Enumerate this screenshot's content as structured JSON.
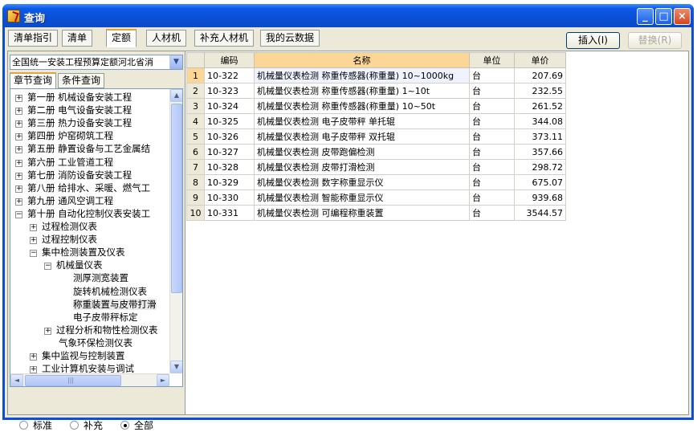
{
  "window": {
    "title": "查询",
    "controls": {
      "minimize": "_",
      "maximize": "□",
      "close": "×"
    }
  },
  "tabs": [
    {
      "label": "清单指引"
    },
    {
      "label": "清单"
    },
    {
      "label": "定额"
    },
    {
      "label": "人材机"
    },
    {
      "label": "补充人材机"
    },
    {
      "label": "我的云数据"
    }
  ],
  "actions": {
    "insert": "插入(I)",
    "replace": "替换(R)"
  },
  "left_panel": {
    "combo_value": "全国统一安装工程预算定额河北省消",
    "subtabs": [
      {
        "label": "章节查询"
      },
      {
        "label": "条件查询"
      }
    ],
    "tree": [
      {
        "label": "第一册  机械设备安装工程",
        "exp": "+"
      },
      {
        "label": "第二册  电气设备安装工程",
        "exp": "+"
      },
      {
        "label": "第三册  热力设备安装工程",
        "exp": "+"
      },
      {
        "label": "第四册  炉窑砌筑工程",
        "exp": "+"
      },
      {
        "label": "第五册  静置设备与工艺金属结",
        "exp": "+"
      },
      {
        "label": "第六册  工业管道工程",
        "exp": "+"
      },
      {
        "label": "第七册  消防设备安装工程",
        "exp": "+"
      },
      {
        "label": "第八册  给排水、采暖、燃气工",
        "exp": "+"
      },
      {
        "label": "第九册  通风空调工程",
        "exp": "+"
      },
      {
        "label": "第十册  自动化控制仪表安装工",
        "exp": "−"
      },
      {
        "label": "过程检测仪表",
        "exp": "+"
      },
      {
        "label": "过程控制仪表",
        "exp": "+"
      },
      {
        "label": "集中检测装置及仪表",
        "exp": "−"
      },
      {
        "label": "机械量仪表",
        "exp": "−"
      },
      {
        "label": "测厚测宽装置",
        "exp": ""
      },
      {
        "label": "旋转机械检测仪表",
        "exp": ""
      },
      {
        "label": "称重装置与皮带打滑",
        "exp": ""
      },
      {
        "label": "电子皮带秤标定",
        "exp": ""
      },
      {
        "label": "过程分析和物性检测仪表",
        "exp": "+"
      },
      {
        "label": "气象环保检测仪表",
        "exp": ""
      },
      {
        "label": "集中监视与控制装置",
        "exp": "+"
      },
      {
        "label": "工业计算机安装与调试",
        "exp": "+"
      }
    ],
    "scroll": {
      "up": "▲",
      "down": "▼",
      "left": "◄",
      "right": "►",
      "grip": "|||"
    },
    "radios": [
      {
        "label": "标准",
        "checked": false
      },
      {
        "label": "补充",
        "checked": false
      },
      {
        "label": "全部",
        "checked": true
      }
    ]
  },
  "grid": {
    "columns": [
      "",
      "编码",
      "名称",
      "单位",
      "单价"
    ],
    "rows": [
      {
        "n": "1",
        "code": "10-322",
        "name": "机械量仪表检测 称重传感器(称重量) 10~1000kg",
        "unit": "台",
        "price": "207.69"
      },
      {
        "n": "2",
        "code": "10-323",
        "name": "机械量仪表检测 称重传感器(称重量) 1~10t",
        "unit": "台",
        "price": "232.55"
      },
      {
        "n": "3",
        "code": "10-324",
        "name": "机械量仪表检测 称重传感器(称重量) 10~50t",
        "unit": "台",
        "price": "261.52"
      },
      {
        "n": "4",
        "code": "10-325",
        "name": "机械量仪表检测 电子皮带秤 单托辊",
        "unit": "台",
        "price": "344.08"
      },
      {
        "n": "5",
        "code": "10-326",
        "name": "机械量仪表检测 电子皮带秤 双托辊",
        "unit": "台",
        "price": "373.11"
      },
      {
        "n": "6",
        "code": "10-327",
        "name": "机械量仪表检测 皮带跑偏检测",
        "unit": "台",
        "price": "357.66"
      },
      {
        "n": "7",
        "code": "10-328",
        "name": "机械量仪表检测 皮带打滑检测",
        "unit": "台",
        "price": "298.72"
      },
      {
        "n": "8",
        "code": "10-329",
        "name": "机械量仪表检测 数字称重显示仪",
        "unit": "台",
        "price": "675.07"
      },
      {
        "n": "9",
        "code": "10-330",
        "name": "机械量仪表检测 智能称重显示仪",
        "unit": "台",
        "price": "939.68"
      },
      {
        "n": "10",
        "code": "10-331",
        "name": "机械量仪表检测 可编程称重装置",
        "unit": "台",
        "price": "3544.57"
      }
    ]
  }
}
